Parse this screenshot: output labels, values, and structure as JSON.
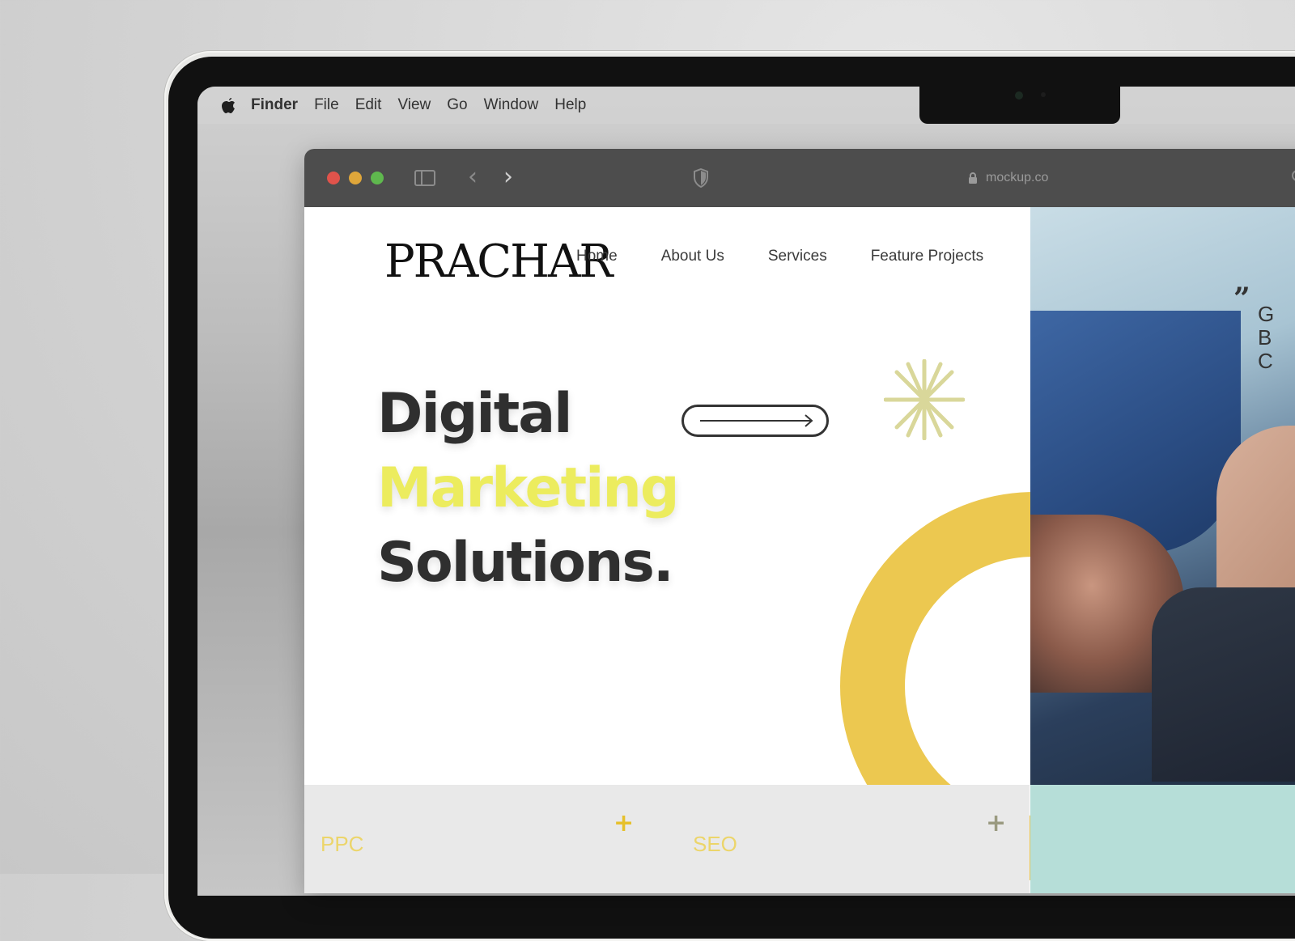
{
  "menubar": {
    "apple_icon": "apple-icon",
    "items": [
      "Finder",
      "File",
      "Edit",
      "View",
      "Go",
      "Window",
      "Help"
    ]
  },
  "browser": {
    "url": "mockup.co"
  },
  "site": {
    "logo": "PRACHAR",
    "nav": [
      "Home",
      "About Us",
      "Services",
      "Feature Projects"
    ],
    "headline": {
      "line1": "Digital",
      "line2": "Marketing",
      "line3": "Solutions."
    },
    "cards": [
      {
        "label": "PPC",
        "plus_color": "#e6c02c"
      },
      {
        "label": "SEO",
        "plus_color": "#9a9a80"
      }
    ],
    "quote_mark": "”",
    "quote_lines": [
      "G",
      "B",
      "C"
    ]
  },
  "colors": {
    "accent_yellow": "#ecc850",
    "headline_yellow": "#ecec5e",
    "teal": "#b6ded8"
  }
}
